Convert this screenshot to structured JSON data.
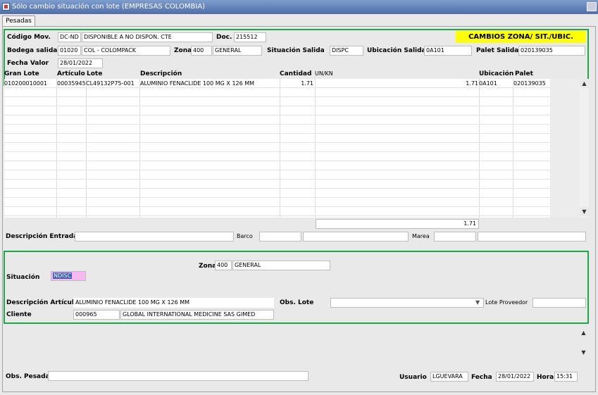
{
  "window": {
    "title": "Sólo cambio situación con lote (EMPRESAS COLOMBIA)"
  },
  "tab": {
    "label": "Pesadas"
  },
  "header": {
    "banner": "CAMBIOS ZONA/ SIT./UBIC.",
    "codigo_mov_label": "Código Mov.",
    "codigo_mov_code": "DC-ND",
    "codigo_mov_desc": "DISPONIBLE A NO DISPON. CTE",
    "doc_label": "Doc.",
    "doc_value": "215512",
    "bodega_label": "Bodega salida",
    "bodega_code": "01020",
    "bodega_name": "COL - COLOMPACK",
    "zona_label": "Zona",
    "zona_code": "400",
    "zona_name": "GENERAL",
    "situacion_salida_label": "Situación Salida",
    "situacion_salida_value": "DISPC",
    "ubicacion_salida_label": "Ubicación Salida",
    "ubicacion_salida_value": "0A101",
    "palet_salida_label": "Palet Salida",
    "palet_salida_value": "020139035",
    "fecha_valor_label": "Fecha Valor",
    "fecha_valor_value": "28/01/2022"
  },
  "grid": {
    "columns": [
      "Gran Lote",
      "Artículo",
      "Lote",
      "Descripción",
      "Cantidad",
      "UN/KN",
      "Ubicación",
      "Palet"
    ],
    "rows": [
      {
        "gran_lote": "010200010001",
        "articulo": "00035945",
        "lote": "CL49132P75-001",
        "descripcion": "ALUMINIO FENACLIDE 100 MG  X 126 MM",
        "cantidad": "1.71",
        "un_kn": "1.71",
        "ubicacion": "0A101",
        "palet": "020139035"
      }
    ],
    "total": "1.71"
  },
  "entrada": {
    "descripcion_label": "Descripción Entrada",
    "descripcion_value": "",
    "barco_label": "Barco",
    "marea_label": "Marea"
  },
  "destino": {
    "zona_label": "Zona",
    "zona_code": "400",
    "zona_name": "GENERAL",
    "situacion_label": "Situación",
    "situacion_value": "NDISC",
    "desc_articulo_label": "Descripción Artículo",
    "desc_articulo_value": "ALUMINIO FENACLIDE 100 MG  X 126 MM",
    "obs_lote_label": "Obs. Lote",
    "lote_proveedor_label": "Lote Proveedor",
    "cliente_label": "Cliente",
    "cliente_code": "000965",
    "cliente_name": "GLOBAL INTERNATIONAL MEDICINE SAS GIMED"
  },
  "footer": {
    "obs_pesada_label": "Obs. Pesada",
    "usuario_label": "Usuario",
    "usuario_value": "LGUEVARA",
    "fecha_label": "Fecha",
    "fecha_value": "28/01/2022",
    "hora_label": "Hora",
    "hora_value": "15:31"
  },
  "colors": {
    "highlight": "#ffff00",
    "section_border": "#1ea64a",
    "situacion_field": "#f5b8f0"
  }
}
